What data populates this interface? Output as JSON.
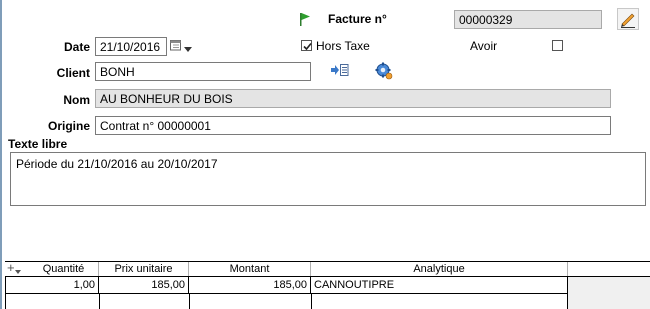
{
  "header": {
    "facture_label": "Facture n°",
    "facture_number": "00000329"
  },
  "fields": {
    "date_label": "Date",
    "date_value": "21/10/2016",
    "hors_taxe_label": "Hors Taxe",
    "hors_taxe_checked": true,
    "avoir_label": "Avoir",
    "avoir_checked": false,
    "client_label": "Client",
    "client_value": "BONH",
    "nom_label": "Nom",
    "nom_value": "AU BONHEUR DU BOIS",
    "origine_label": "Origine",
    "origine_value": "Contrat n° 00000001",
    "texte_libre_label": "Texte libre",
    "texte_libre_value": "Période du 21/10/2016 au 20/10/2017"
  },
  "table": {
    "add_symbol": "+",
    "columns": [
      "Quantité",
      "Prix unitaire",
      "Montant",
      "Analytique"
    ],
    "rows": [
      {
        "quantite": "1,00",
        "prix_unitaire": "185,00",
        "montant": "185,00",
        "analytique": "CANNOUTIPRE"
      }
    ]
  },
  "colors": {
    "flag": "#2e9e2e",
    "readonly_bg": "#e4e4e4",
    "border": "#7a7a7a",
    "accent": "#e07020"
  },
  "icons": [
    "flag-icon",
    "edit-pencil-icon",
    "calendar-icon",
    "dropdown-arrow-icon",
    "client-lookup-icon",
    "client-settings-icon",
    "add-row-icon"
  ]
}
